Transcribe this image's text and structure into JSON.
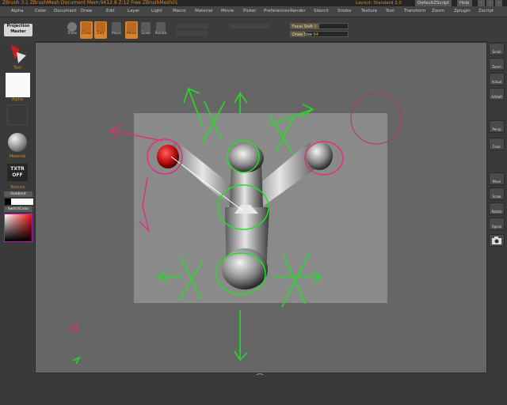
{
  "titlebar": {
    "app_title": "ZBrush 3.1   ZBrushMesh Document   Mem:9612.8  Z:12  Free   ZBrushMesh01",
    "layout_label": "Layout: Standard 2.0",
    "default_script": "DefaultZScript",
    "help": "Help"
  },
  "menu": {
    "items": [
      "Alpha",
      "Color",
      "Document",
      "Draw",
      "Edit",
      "Layer",
      "Light",
      "Macro",
      "Material",
      "Movie",
      "Picker",
      "Preferences",
      "Render",
      "Stencil",
      "Stroke",
      "Texture",
      "Tool",
      "Transform",
      "Zoom",
      "Zplugin",
      "Zscript"
    ]
  },
  "topshelf": {
    "projection_master": [
      "Projection",
      "Master"
    ],
    "tools": [
      {
        "label": "Trans",
        "icon": "transparency-icon",
        "active": false
      },
      {
        "label": "Draw",
        "icon": "draw-icon",
        "active": true
      },
      {
        "label": "Edit",
        "icon": "edit-icon",
        "active": true
      },
      {
        "label": "Move",
        "icon": "move-icon",
        "active": false
      },
      {
        "label": "Move",
        "icon": "move-active-icon",
        "active": true
      },
      {
        "label": "Scale",
        "icon": "scale-icon",
        "active": false
      },
      {
        "label": "Rotate",
        "icon": "rotate-icon",
        "active": false
      }
    ],
    "focal_shift_label": "Focal Shift",
    "focal_shift_value": "0",
    "draw_size_label": "Draw Size",
    "draw_size_value": "64"
  },
  "leftshelf": {
    "tool_label": "Tool",
    "alpha_label": "Alpha",
    "material_label": "Material",
    "texture_label": "Texture",
    "texture_off": [
      "TXTR",
      "OFF"
    ],
    "switch_color": "SwitchColor",
    "gradient": "Gradient"
  },
  "rightshelf": {
    "buttons": [
      {
        "label": "Scroll",
        "icon": "scroll-icon"
      },
      {
        "label": "Zoom",
        "icon": "zoom-icon"
      },
      {
        "label": "Actual",
        "icon": "actual-size-icon"
      },
      {
        "label": "AAHalf",
        "icon": "aahalf-icon"
      },
      {
        "label": "Persp",
        "icon": "persp-icon"
      },
      {
        "label": "Floor",
        "icon": "floor-icon"
      },
      {
        "label": "Move",
        "icon": "move-icon"
      },
      {
        "label": "Scale",
        "icon": "scale-icon"
      },
      {
        "label": "Rotate",
        "icon": "rotate-icon"
      },
      {
        "label": "Xpose",
        "icon": "xpose-icon"
      },
      {
        "label": "",
        "icon": "camera-icon"
      }
    ]
  },
  "colors": {
    "accent": "#d9822b",
    "canvas_bg": "#666666",
    "document_bg": "#8a8a8a",
    "annotation_green": "#22e022",
    "annotation_pink": "#e0307a"
  }
}
